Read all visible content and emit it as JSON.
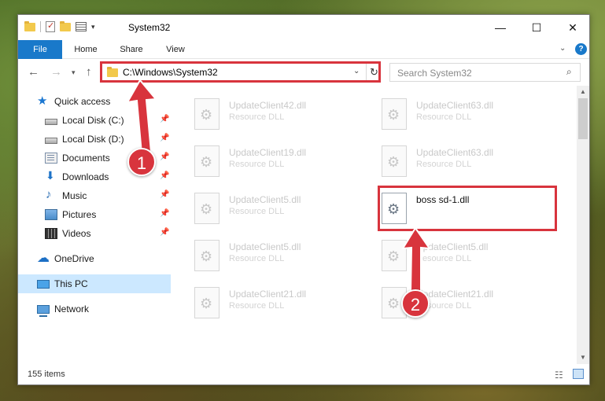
{
  "window": {
    "title": "System32",
    "controls": {
      "minimize": "—",
      "maximize": "☐",
      "close": "✕"
    }
  },
  "ribbon": {
    "tabs": [
      {
        "label": "File"
      },
      {
        "label": "Home"
      },
      {
        "label": "Share"
      },
      {
        "label": "View"
      }
    ],
    "help": "?"
  },
  "navbar": {
    "address": "C:\\Windows\\System32",
    "search_placeholder": "Search System32"
  },
  "sidebar": {
    "items": [
      {
        "label": "Quick access",
        "icon": "star-icon"
      },
      {
        "label": "Local Disk (C:)",
        "icon": "drive-icon",
        "pinned": true
      },
      {
        "label": "Local Disk (D:)",
        "icon": "drive-icon",
        "pinned": true
      },
      {
        "label": "Documents",
        "icon": "documents-icon",
        "pinned": true
      },
      {
        "label": "Downloads",
        "icon": "download-icon",
        "pinned": true
      },
      {
        "label": "Music",
        "icon": "music-icon",
        "pinned": true
      },
      {
        "label": "Pictures",
        "icon": "pictures-icon",
        "pinned": true
      },
      {
        "label": "Videos",
        "icon": "videos-icon",
        "pinned": true
      },
      {
        "label": "OneDrive",
        "icon": "cloud-icon"
      },
      {
        "label": "This PC",
        "icon": "computer-icon",
        "selected": true
      },
      {
        "label": "Network",
        "icon": "network-icon"
      }
    ]
  },
  "files": [
    {
      "name": "UpdateClient42.dll",
      "desc": "Resource DLL"
    },
    {
      "name": "UpdateClient63.dll",
      "desc": "Resource DLL"
    },
    {
      "name": "UpdateClient19.dll",
      "desc": "Resource DLL"
    },
    {
      "name": "UpdateClient63.dll",
      "desc": "Resource DLL"
    },
    {
      "name": "UpdateClient5.dll",
      "desc": "Resource DLL"
    },
    {
      "name": "boss sd-1.dll",
      "desc": ""
    },
    {
      "name": "UpdateClient5.dll",
      "desc": "Resource DLL"
    },
    {
      "name": "UpdateClient5.dll",
      "desc": "Resource DLL"
    },
    {
      "name": "UpdateClient21.dll",
      "desc": "Resource DLL"
    },
    {
      "name": "UpdateClient21.dll",
      "desc": "Resource DLL"
    }
  ],
  "status": {
    "count": "155 items"
  },
  "callouts": [
    {
      "label": "1"
    },
    {
      "label": "2"
    }
  ],
  "colors": {
    "accent": "#1979ca",
    "highlight": "#d8343d",
    "selected": "#cce8ff"
  }
}
